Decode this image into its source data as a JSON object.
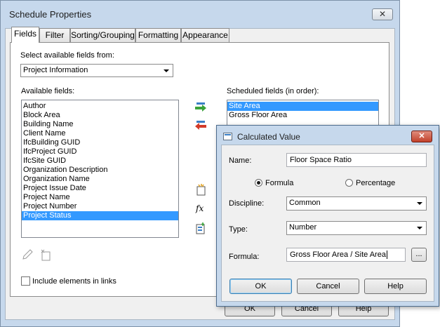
{
  "main_dialog": {
    "title": "Schedule Properties",
    "close_glyph": "✕",
    "tabs": [
      {
        "label": "Fields",
        "active": true
      },
      {
        "label": "Filter",
        "active": false
      },
      {
        "label": "Sorting/Grouping",
        "active": false
      },
      {
        "label": "Formatting",
        "active": false
      },
      {
        "label": "Appearance",
        "active": false
      }
    ],
    "select_from_label": "Select available fields from:",
    "select_from_value": "Project Information",
    "available_label": "Available fields:",
    "available_fields": [
      "Author",
      "Block Area",
      "Building Name",
      "Client Name",
      "IfcBuilding GUID",
      "IfcProject GUID",
      "IfcSite GUID",
      "Organization Description",
      "Organization Name",
      "Project Issue Date",
      "Project Name",
      "Project Number",
      "Project Status"
    ],
    "available_selected": "Project Status",
    "scheduled_label": "Scheduled fields (in order):",
    "scheduled_fields": [
      "Site Area",
      "Gross Floor Area"
    ],
    "scheduled_selected": "Site Area",
    "include_links_label": "Include elements in links",
    "include_links_checked": false,
    "footer": {
      "ok": "OK",
      "cancel": "Cancel",
      "help": "Help"
    }
  },
  "calc_dialog": {
    "title": "Calculated Value",
    "close_glyph": "✕",
    "name_label": "Name:",
    "name_value": "Floor Space Ratio",
    "radio_formula": "Formula",
    "radio_percentage": "Percentage",
    "selected_mode": "Formula",
    "discipline_label": "Discipline:",
    "discipline_value": "Common",
    "type_label": "Type:",
    "type_value": "Number",
    "formula_label": "Formula:",
    "formula_value": "Gross Floor Area / Site Area",
    "browse_label": "...",
    "ok": "OK",
    "cancel": "Cancel",
    "help": "Help"
  },
  "colors": {
    "selection": "#3399ff",
    "frame": "#c6d8ec",
    "close_red": "#c2412b"
  }
}
